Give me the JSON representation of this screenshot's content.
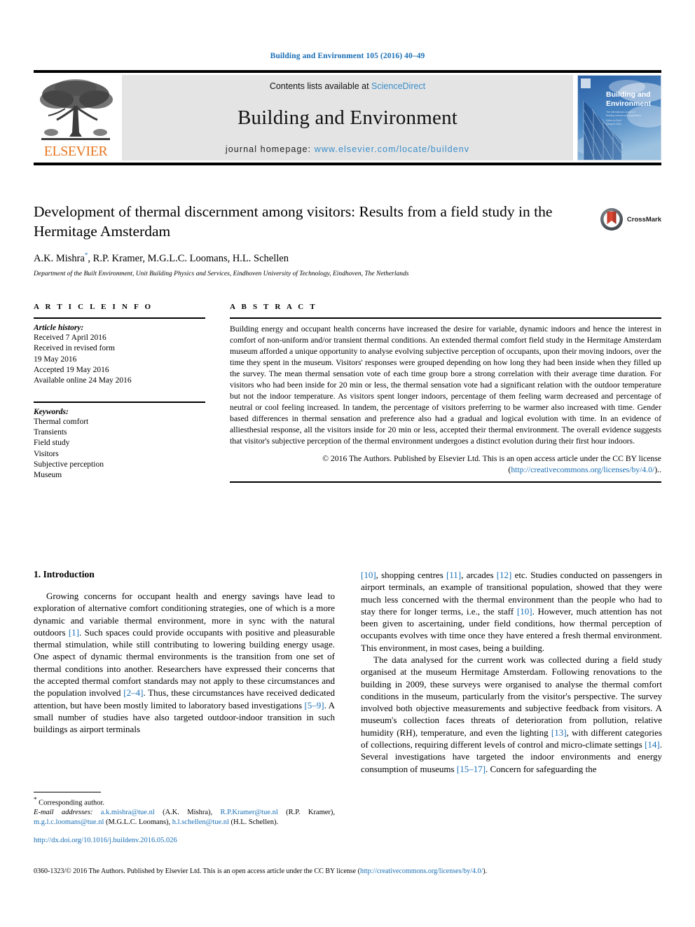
{
  "running_head": "Building and Environment 105 (2016) 40–49",
  "masthead": {
    "publisher_name": "ELSEVIER",
    "contents_prefix": "Contents lists available at ",
    "contents_link": "ScienceDirect",
    "journal_title": "Building and Environment",
    "homepage_prefix": "journal homepage: ",
    "homepage_url": "www.elsevier.com/locate/buildenv",
    "cover_title_line1": "Building and",
    "cover_title_line2": "Environment",
    "accent_blue": "#3a8dc9",
    "elsevier_orange": "#e87722",
    "banner_gray": "#e4e4e4"
  },
  "article": {
    "title": "Development of thermal discernment among visitors: Results from a field study in the Hermitage Amsterdam",
    "crossmark_label": "CrossMark",
    "authors": "A.K. Mishra",
    "authors_rest": ", R.P. Kramer, M.G.L.C. Loomans, H.L. Schellen",
    "corresponding_marker": "*",
    "affiliation": "Department of the Built Environment, Unit Building Physics and Services, Eindhoven University of Technology, Eindhoven, The Netherlands"
  },
  "article_info": {
    "heading": "A R T I C L E  I N F O",
    "history_label": "Article history:",
    "history_lines": [
      "Received 7 April 2016",
      "Received in revised form",
      "19 May 2016",
      "Accepted 19 May 2016",
      "Available online 24 May 2016"
    ],
    "keywords_label": "Keywords:",
    "keywords": [
      "Thermal comfort",
      "Transients",
      "Field study",
      "Visitors",
      "Subjective perception",
      "Museum"
    ]
  },
  "abstract": {
    "heading": "A B S T R A C T",
    "body": "Building energy and occupant health concerns have increased the desire for variable, dynamic indoors and hence the interest in comfort of non-uniform and/or transient thermal conditions. An extended thermal comfort field study in the Hermitage Amsterdam museum afforded a unique opportunity to analyse evolving subjective perception of occupants, upon their moving indoors, over the time they spent in the museum. Visitors' responses were grouped depending on how long they had been inside when they filled up the survey. The mean thermal sensation vote of each time group bore a strong correlation with their average time duration. For visitors who had been inside for 20 min or less, the thermal sensation vote had a significant relation with the outdoor temperature but not the indoor temperature. As visitors spent longer indoors, percentage of them feeling warm decreased and percentage of neutral or cool feeling increased. In tandem, the percentage of visitors preferring to be warmer also increased with time. Gender based differences in thermal sensation and preference also had a gradual and logical evolution with time. In an evidence of alliesthesial response, all the visitors inside for 20 min or less, accepted their thermal environment. The overall evidence suggests that visitor's subjective perception of the thermal environment undergoes a distinct evolution during their first hour indoors.",
    "copyright_text": "© 2016 The Authors. Published by Elsevier Ltd. This is an open access article under the CC BY license",
    "license_open_paren": "(",
    "license_url": "http://creativecommons.org/licenses/by/4.0/",
    "license_close_paren": ").."
  },
  "introduction": {
    "number_and_title": "1. Introduction",
    "left_para_1_a": "Growing concerns for occupant health and energy savings have lead to exploration of alternative comfort conditioning strategies, one of which is a more dynamic and variable thermal environment, more in sync with the natural outdoors ",
    "left_ref_1": "[1]",
    "left_para_1_b": ". Such spaces could provide occupants with positive and pleasurable thermal stimulation, while still contributing to lowering building energy usage. One aspect of dynamic thermal environments is the transition from one set of thermal conditions into another. Researchers have expressed their concerns that the accepted thermal comfort standards may not apply to these circumstances and the population involved ",
    "left_ref_2": "[2–4]",
    "left_para_1_c": ". Thus, these circumstances have received dedicated attention, but have been mostly limited to laboratory based investigations ",
    "left_ref_3": "[5–9]",
    "left_para_1_d": ". A small number of studies have also targeted outdoor-indoor transition in such buildings as airport terminals",
    "right_ref_10a": "[10]",
    "right_para_a": ", shopping centres ",
    "right_ref_11": "[11]",
    "right_para_b": ", arcades ",
    "right_ref_12": "[12]",
    "right_para_c": " etc. Studies conducted on passengers in airport terminals, an example of transitional population, showed that they were much less concerned with the thermal environment than the people who had to stay there for longer terms, i.e., the staff ",
    "right_ref_10b": "[10]",
    "right_para_d": ". However, much attention has not been given to ascertaining, under field conditions, how thermal perception of occupants evolves with time once they have entered a fresh thermal environment. This environment, in most cases, being a building.",
    "right_para2_a": "The data analysed for the current work was collected during a field study organised at the museum Hermitage Amsterdam. Following renovations to the building in 2009, these surveys were organised to analyse the thermal comfort conditions in the museum, particularly from the visitor's perspective. The survey involved both objective measurements and subjective feedback from visitors. A museum's collection faces threats of deterioration from pollution, relative humidity (RH), temperature, and even the lighting ",
    "right_ref_13": "[13]",
    "right_para2_b": ", with different categories of collections, requiring different levels of control and micro-climate settings ",
    "right_ref_14": "[14]",
    "right_para2_c": ". Several investigations have targeted the indoor environments and energy consumption of museums ",
    "right_ref_15": "[15–17]",
    "right_para2_d": ". Concern for safeguarding the"
  },
  "footnote": {
    "corresponding_star": "*",
    "corresponding_text": " Corresponding author.",
    "email_label": "E-mail addresses:",
    "emails": [
      {
        "address": "a.k.mishra@tue.nl",
        "owner": "(A.K. Mishra),"
      },
      {
        "address": "R.P.Kramer@tue.nl",
        "owner": "(R.P. Kramer),"
      },
      {
        "address": "m.g.l.c.loomans@tue.nl",
        "owner": "(M.G.L.C. Loomans),"
      },
      {
        "address": "h.l.schellen@tue.nl",
        "owner": "(H.L. Schellen)."
      }
    ],
    "doi_url": "http://dx.doi.org/10.1016/j.buildenv.2016.05.026"
  },
  "page_footer": {
    "issn_copyright": "0360-1323/© 2016 The Authors. Published by Elsevier Ltd. This is an open access article under the CC BY license (",
    "license_url": "http://creativecommons.org/licenses/by/4.0/",
    "tail": ")."
  }
}
